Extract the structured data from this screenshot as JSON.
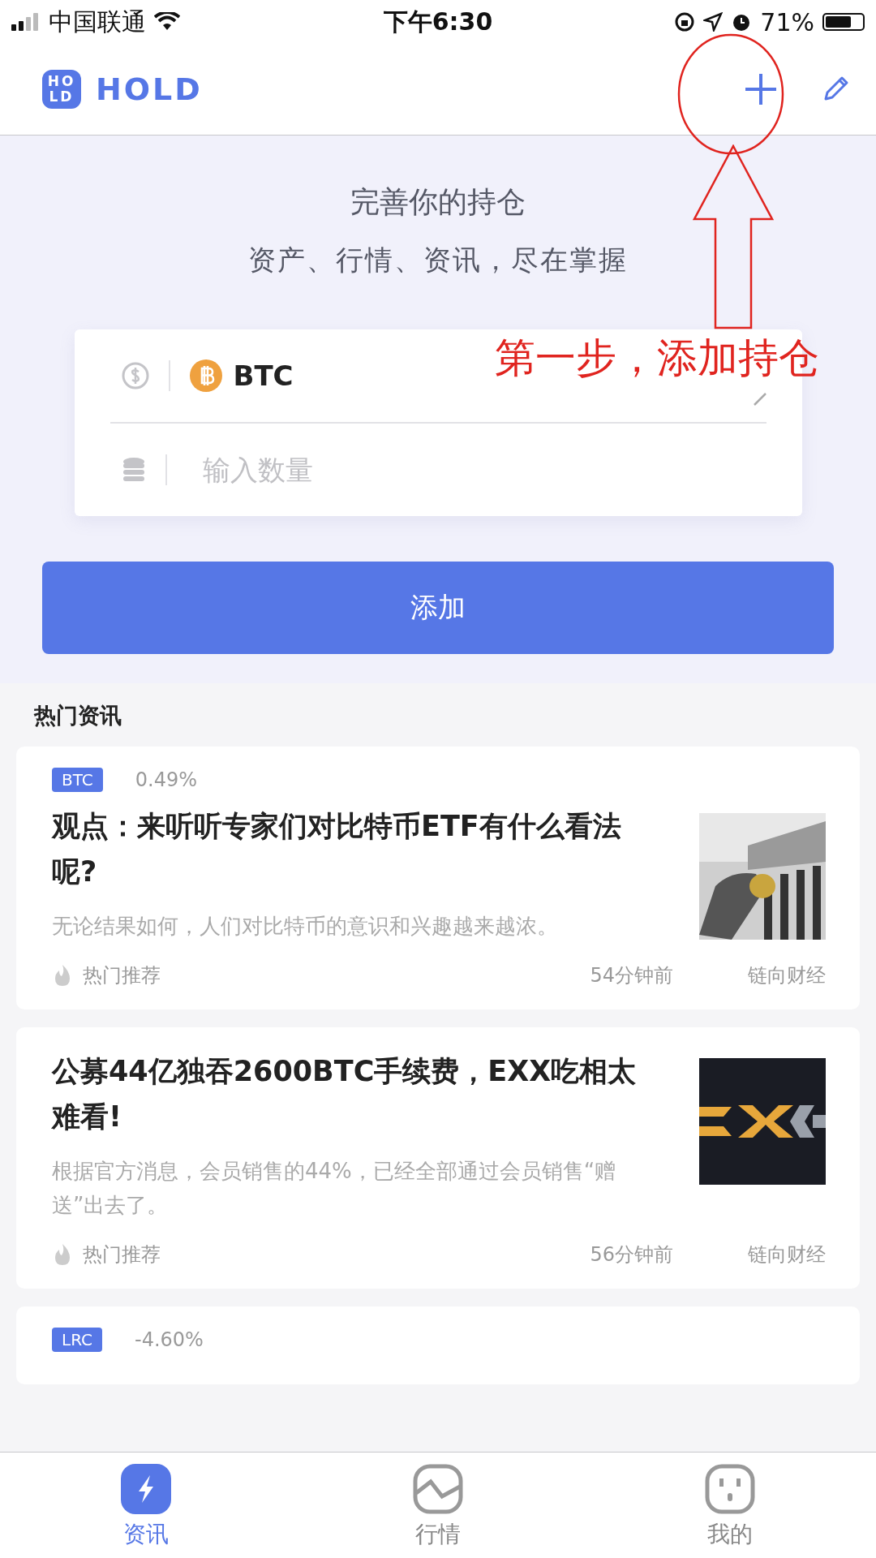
{
  "status_bar": {
    "carrier": "中国联通",
    "time": "下午6:30",
    "battery": "71%"
  },
  "header": {
    "logo_text": "HOLD",
    "logo_mark": [
      "HO",
      "LD"
    ]
  },
  "hero": {
    "title": "完善你的持仓",
    "subtitle": "资产、行情、资讯，尽在掌握"
  },
  "form": {
    "coin": "BTC",
    "amount": {
      "placeholder": "输入数量"
    },
    "submit": "添加"
  },
  "annotation": {
    "text": "第一步，添加持仓"
  },
  "section_title": "热门资讯",
  "news": [
    {
      "tag": "BTC",
      "change": "0.49%",
      "title": "观点：来听听专家们对比特币ETF有什么看法呢?",
      "summary": "无论结果如何，人们对比特币的意识和兴趣越来越浓。",
      "label": "热门推荐",
      "time": "54分钟前",
      "source": "链向财经"
    },
    {
      "title": "公募44亿独吞2600BTC手续费，EXX吃相太难看!",
      "summary": "根据官方消息，会员销售的44%，已经全部通过会员销售“赠送”出去了。",
      "label": "热门推荐",
      "time": "56分钟前",
      "source": "链向财经"
    },
    {
      "tag": "LRC",
      "change": "-4.60%"
    }
  ],
  "tabs": [
    {
      "label": "资讯",
      "selected": true
    },
    {
      "label": "行情",
      "selected": false
    },
    {
      "label": "我的",
      "selected": false
    }
  ]
}
